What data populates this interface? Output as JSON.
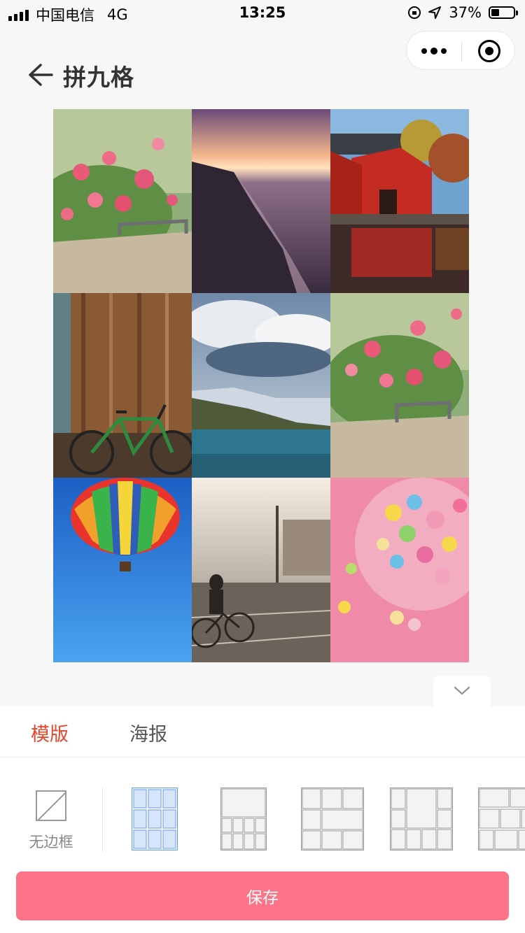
{
  "status_bar": {
    "carrier": "中国电信",
    "network": "4G",
    "time": "13:25",
    "battery": "37%",
    "battery_level": 0.37
  },
  "nav": {
    "title": "拼九格",
    "back_icon": "arrow-left-icon"
  },
  "capsule": {
    "more_icon": "more-dots-icon",
    "close_icon": "target-close-icon"
  },
  "collage": {
    "photos": [
      "pink-flowers-in-bucket",
      "sunset-sea-coast",
      "red-house-by-water",
      "wooden-wall-green-bicycle",
      "clouds-mountains-lake",
      "pink-flowers-in-bucket",
      "rainbow-hot-air-balloon",
      "cyclist-on-sunlit-street",
      "colorful-cereal-in-glass-bowl"
    ]
  },
  "tabs": [
    {
      "label": "模版",
      "active": true
    },
    {
      "label": "海报",
      "active": false
    }
  ],
  "layouts": {
    "no_border_label": "无边框",
    "options": [
      {
        "name": "grid-3x3",
        "selected": true
      },
      {
        "name": "big-top-small-bottom",
        "selected": false
      },
      {
        "name": "three-rows-mixed",
        "selected": false
      },
      {
        "name": "big-center-frame",
        "selected": false
      },
      {
        "name": "brick-rows",
        "selected": false
      }
    ]
  },
  "save_button": "保存",
  "colors": {
    "accent": "#e8472d",
    "save_button": "#fd7488",
    "selected_layout": "#6c9be6"
  }
}
